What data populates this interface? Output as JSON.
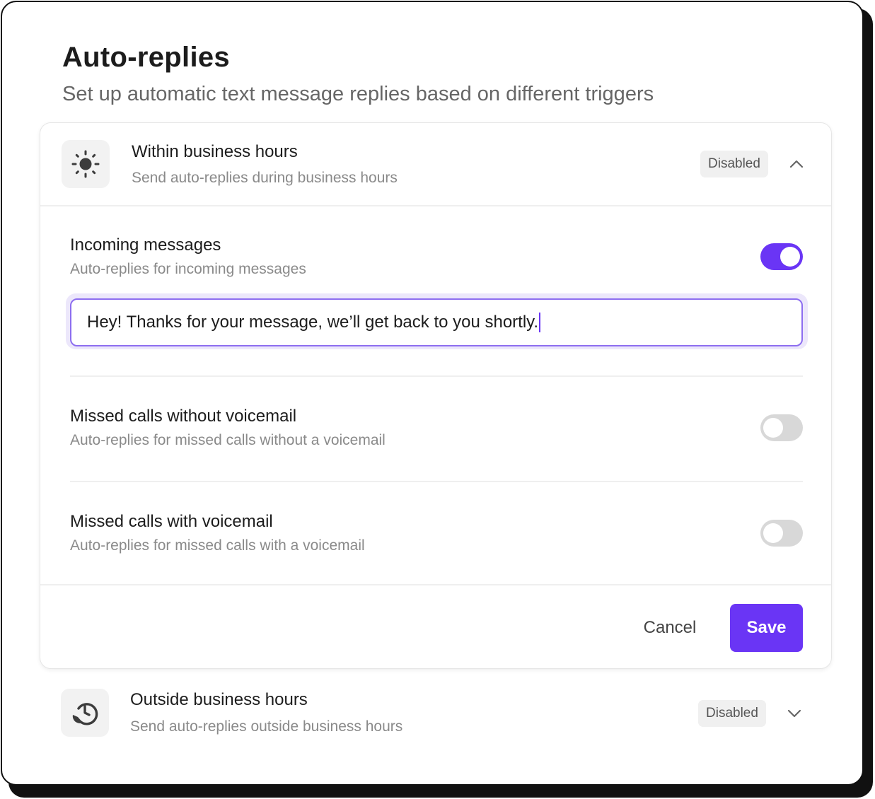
{
  "page": {
    "title": "Auto-replies",
    "subtitle": "Set up automatic text message replies based on different triggers"
  },
  "sections": [
    {
      "icon": "sun-icon",
      "title": "Within business hours",
      "description": "Send auto-replies during business hours",
      "badge": "Disabled",
      "expanded": true,
      "chevron": "chevron-up-icon"
    },
    {
      "icon": "clock-history-icon",
      "title": "Outside business hours",
      "description": "Send auto-replies outside business hours",
      "badge": "Disabled",
      "expanded": false,
      "chevron": "chevron-down-icon"
    }
  ],
  "rows": [
    {
      "title": "Incoming messages",
      "description": "Auto-replies for incoming messages",
      "enabled": true,
      "message": "Hey! Thanks for your message, we’ll get back to you shortly."
    },
    {
      "title": "Missed calls without voicemail",
      "description": "Auto-replies for missed calls without a voicemail",
      "enabled": false
    },
    {
      "title": "Missed calls with voicemail",
      "description": "Auto-replies for missed calls with a voicemail",
      "enabled": false
    }
  ],
  "actions": {
    "cancel_label": "Cancel",
    "save_label": "Save"
  },
  "colors": {
    "accent": "#6a35f5",
    "toggle_off": "#d8d8d8",
    "badge_bg": "#f0f0f0"
  }
}
